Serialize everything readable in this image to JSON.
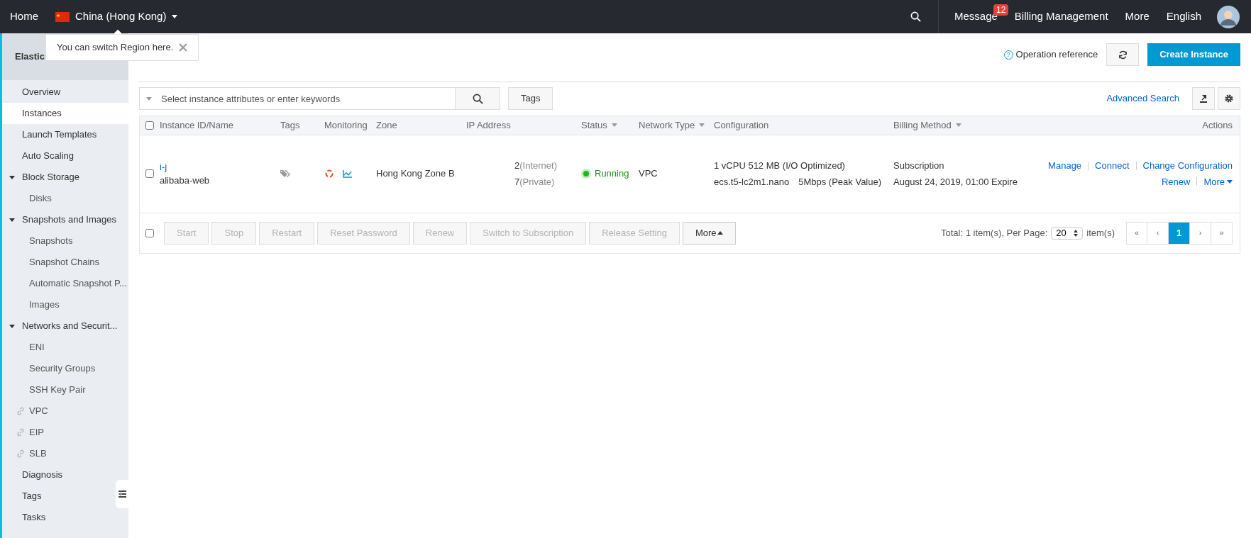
{
  "topbar": {
    "home": "Home",
    "region": "China (Hong Kong)",
    "message": "Message",
    "message_count": "12",
    "links": [
      "Billing Management",
      "More",
      "English"
    ]
  },
  "tooltip": {
    "text": "You can switch Region here."
  },
  "sidebar": {
    "title": "Elastic",
    "items": [
      {
        "kind": "item",
        "label": "Overview",
        "selected": false
      },
      {
        "kind": "item",
        "label": "Instances",
        "selected": true
      },
      {
        "kind": "item",
        "label": "Launch Templates",
        "selected": false
      },
      {
        "kind": "item",
        "label": "Auto Scaling",
        "selected": false
      },
      {
        "kind": "group",
        "label": "Block Storage",
        "expanded": true,
        "children": [
          {
            "label": "Disks",
            "selected": false
          }
        ]
      },
      {
        "kind": "group",
        "label": "Snapshots and Images",
        "expanded": true,
        "children": [
          {
            "label": "Snapshots",
            "selected": false
          },
          {
            "label": "Snapshot Chains",
            "selected": false
          },
          {
            "label": "Automatic Snapshot P...",
            "selected": false
          },
          {
            "label": "Images",
            "selected": false
          }
        ]
      },
      {
        "kind": "group",
        "label": "Networks and Securit...",
        "expanded": true,
        "children": [
          {
            "label": "ENI",
            "selected": false
          },
          {
            "label": "Security Groups",
            "selected": false
          },
          {
            "label": "SSH Key Pair",
            "selected": false
          }
        ]
      },
      {
        "kind": "link",
        "label": "VPC",
        "selected": false
      },
      {
        "kind": "link",
        "label": "EIP",
        "selected": false
      },
      {
        "kind": "link",
        "label": "SLB",
        "selected": false
      },
      {
        "kind": "item",
        "label": "Diagnosis",
        "selected": false
      },
      {
        "kind": "item",
        "label": "Tags",
        "selected": false
      },
      {
        "kind": "item",
        "label": "Tasks",
        "selected": false
      }
    ]
  },
  "header": {
    "help_icon": "?",
    "operation_reference": "Operation reference",
    "create_button": "Create Instance"
  },
  "search": {
    "placeholder": "Select instance attributes or enter keywords",
    "tags_button": "Tags",
    "advanced_search": "Advanced Search"
  },
  "table": {
    "select_all_checked": false,
    "columns": [
      {
        "label": "Instance ID/Name",
        "dropdown": false
      },
      {
        "label": "Tags",
        "dropdown": false
      },
      {
        "label": "Monitoring",
        "dropdown": false
      },
      {
        "label": "Zone",
        "dropdown": false
      },
      {
        "label": "IP Address",
        "dropdown": false
      },
      {
        "label": "Status",
        "dropdown": true
      },
      {
        "label": "Network Type",
        "dropdown": true
      },
      {
        "label": "Configuration",
        "dropdown": false
      },
      {
        "label": "Billing Method",
        "dropdown": true
      },
      {
        "label": "Actions",
        "dropdown": false
      }
    ],
    "rows": [
      {
        "checked": false,
        "id": "i-j",
        "name": "alibaba-web",
        "zone": "Hong Kong Zone B",
        "ip_public": "2",
        "ip_public_label": "(Internet)",
        "ip_private": "7",
        "ip_private_label": "(Private)",
        "status": "Running",
        "active": true,
        "network": "VPC",
        "config_1": "1 vCPU 512 MB (I/O Optimized)",
        "config_2": "ecs.t5-lc2m1.nano",
        "bandwidth": "5Mbps (Peak Value)",
        "billing": "Subscription",
        "expire": "August 24, 2019, 01:00 Expire",
        "actions": [
          [
            {
              "label": "Manage",
              "caret": false
            },
            {
              "label": "Connect",
              "caret": false
            },
            {
              "label": "Change Configuration",
              "caret": false
            }
          ],
          [
            {
              "label": "Renew",
              "caret": false
            },
            {
              "label": "More",
              "caret": true
            }
          ]
        ]
      }
    ]
  },
  "bulk_select_checked": false,
  "bulk_actions": [
    {
      "label": "Start",
      "disabled": true
    },
    {
      "label": "Stop",
      "disabled": true
    },
    {
      "label": "Restart",
      "disabled": true
    },
    {
      "label": "Reset Password",
      "disabled": true
    },
    {
      "label": "Renew",
      "disabled": true
    },
    {
      "label": "Switch to Subscription",
      "disabled": true
    },
    {
      "label": "Release Setting",
      "disabled": true
    },
    {
      "label": "More",
      "disabled": false
    }
  ],
  "pagination": {
    "total": "Total: 1 item(s), Per Page:",
    "per_page": "20",
    "items": "item(s)",
    "pages": [
      {
        "label": "«",
        "selected": false
      },
      {
        "label": "‹",
        "selected": false
      },
      {
        "label": "1",
        "selected": true
      },
      {
        "label": "›",
        "selected": false
      },
      {
        "label": "»",
        "selected": false
      }
    ]
  }
}
